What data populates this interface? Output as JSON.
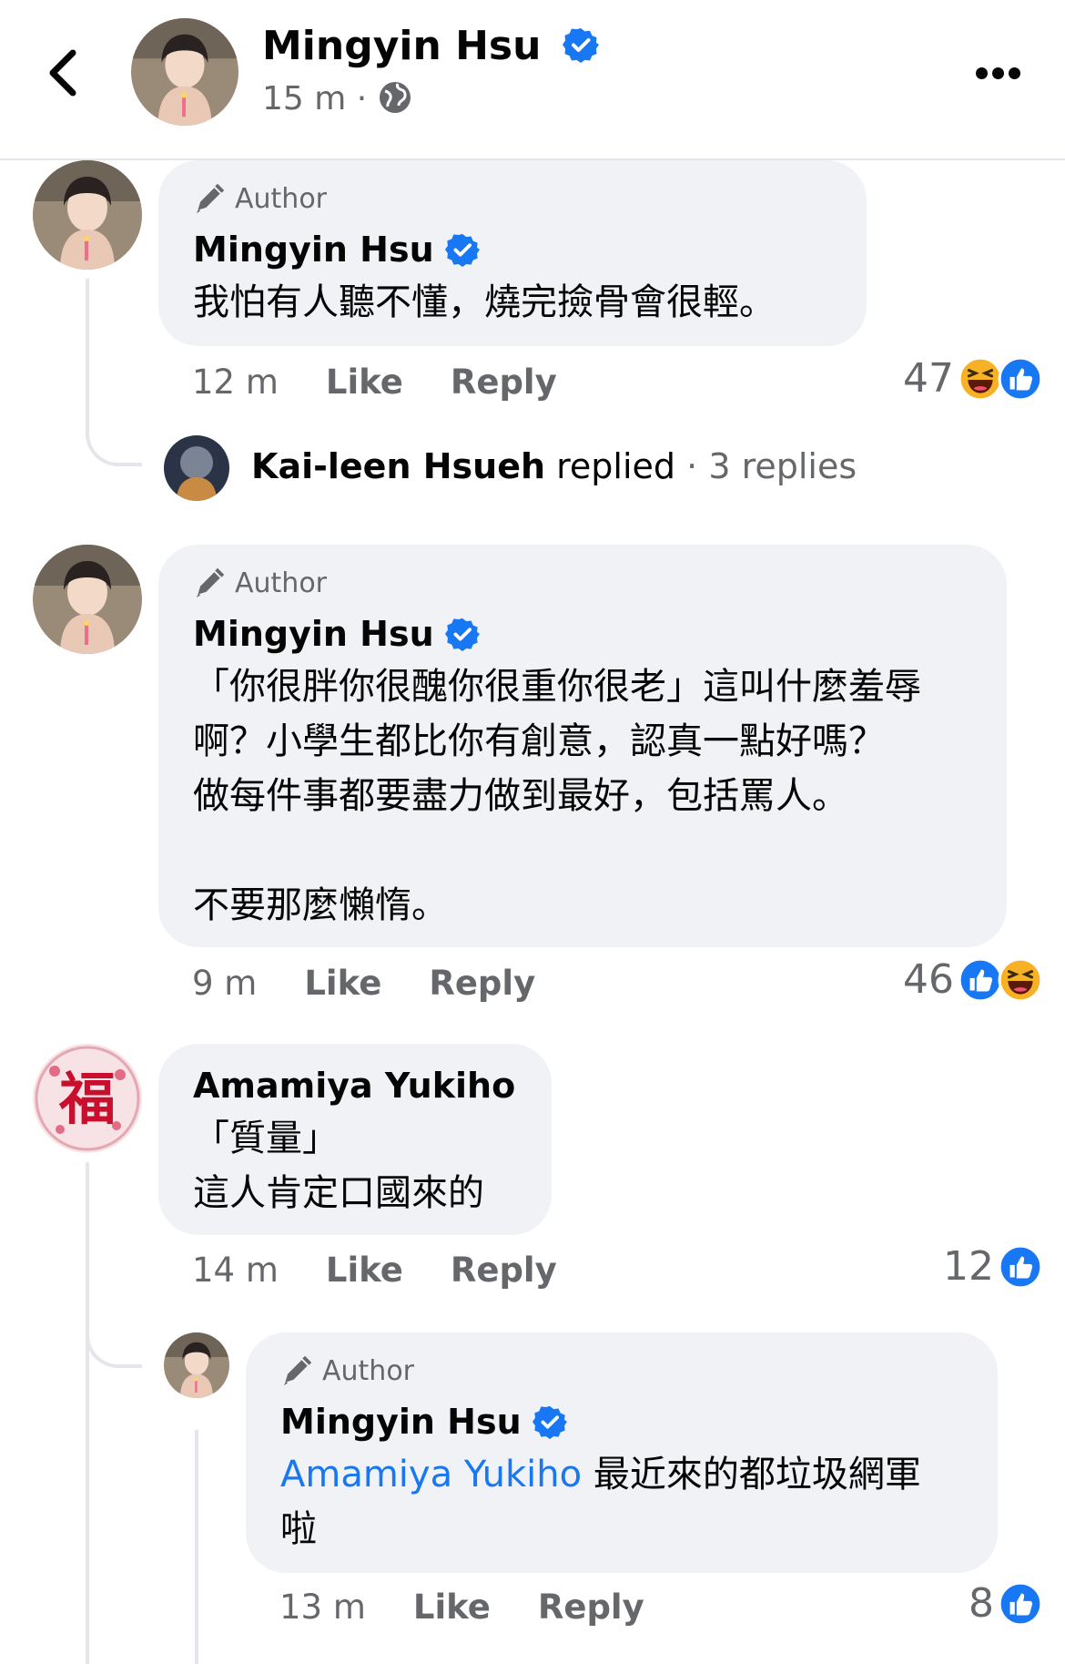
{
  "header": {
    "back_icon": "chevron-left-icon",
    "name": "Mingyin Hsu",
    "time": "15 m",
    "separator": "·",
    "audience_icon": "globe-icon",
    "more_icon": "more-dots-icon"
  },
  "comments": [
    {
      "tag": "Author",
      "name": "Mingyin Hsu",
      "text": "我怕有人聽不懂，燒完撿骨會很輕。",
      "time": "12 m",
      "like": "Like",
      "reply": "Reply",
      "reaction_count": "47",
      "reactions": [
        "haha",
        "like"
      ],
      "replies_summary": {
        "who": "Kai-leen Hsueh",
        "verb": "replied",
        "dot": "·",
        "count": "3 replies"
      }
    },
    {
      "tag": "Author",
      "name": "Mingyin Hsu",
      "text": "「你很胖你很醜你很重你很老」這叫什麼羞辱\n啊？小學生都比你有創意，認真一點好嗎？\n做每件事都要盡力做到最好，包括罵人。\n\n不要那麼懶惰。",
      "time": "9 m",
      "like": "Like",
      "reply": "Reply",
      "reaction_count": "46",
      "reactions": [
        "like",
        "haha"
      ]
    },
    {
      "name": "Amamiya Yukiho",
      "text": "「質量」\n這人肯定口國來的",
      "time": "14 m",
      "like": "Like",
      "reply": "Reply",
      "reaction_count": "12",
      "reactions": [
        "like"
      ],
      "avatar_glyph": "福"
    },
    {
      "tag": "Author",
      "name": "Mingyin Hsu",
      "mention": "Amamiya Yukiho",
      "text_line1": " 最近來的都垃圾網軍",
      "text_line2": "啦",
      "time": "13 m",
      "like": "Like",
      "reply": "Reply",
      "reaction_count": "8",
      "reactions": [
        "like"
      ]
    }
  ],
  "colors": {
    "verified": "#1877f2",
    "like": "#1877f2",
    "haha": "#f7b125",
    "bubble": "#f0f2f5",
    "secondary_text": "#65676b"
  }
}
